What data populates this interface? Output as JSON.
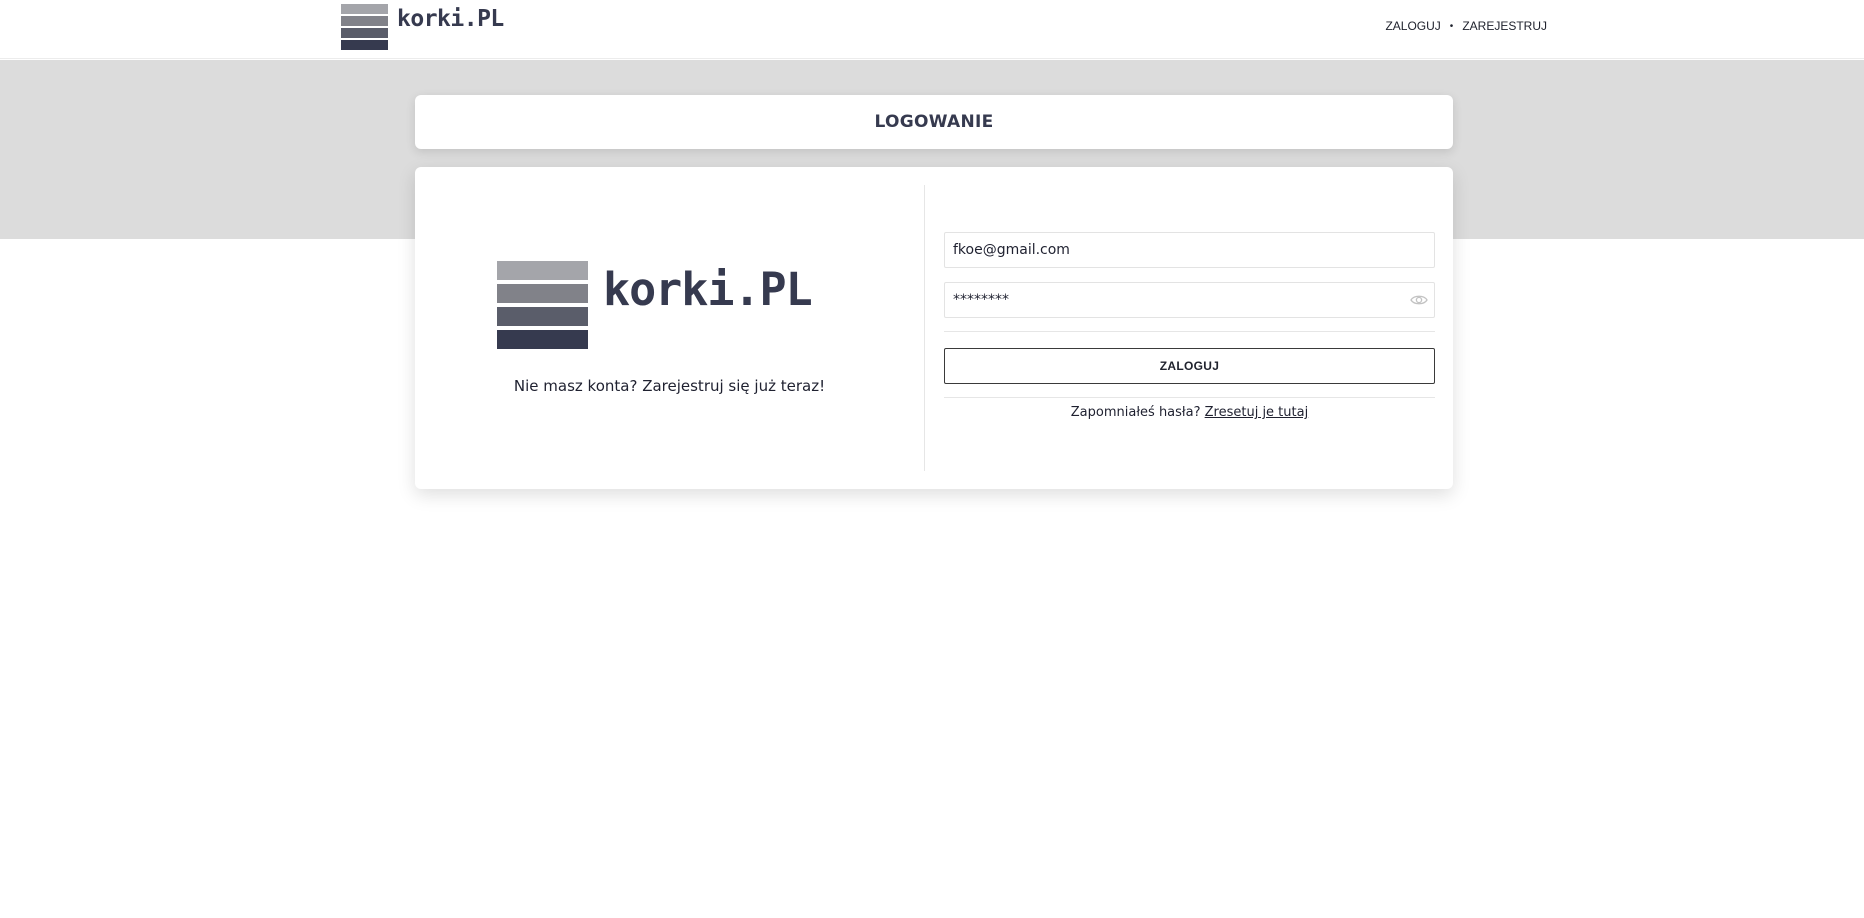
{
  "header": {
    "logo_text": "korki.PL",
    "nav": {
      "login": "ZALOGUJ",
      "separator": "•",
      "register": "ZAREJESTRUJ"
    }
  },
  "title_card": {
    "title": "LOGOWANIE"
  },
  "left_panel": {
    "logo_text": "korki.PL",
    "register_prompt": "Nie masz konta? Zarejestruj się już teraz!"
  },
  "form": {
    "email_value": "fkoe@gmail.com",
    "password_value": "********",
    "submit_label": "ZALOGUJ",
    "forgot_prefix": "Zapomniałeś hasła?",
    "reset_link": "Zresetuj je tutaj"
  },
  "colors": {
    "bar1": "#a4a5aa",
    "bar2": "#818289",
    "bar3": "#5a5d6a",
    "bar4": "#363a4f",
    "band": "#dcdcdc"
  },
  "icons": {
    "password_toggle": "eye-icon"
  }
}
